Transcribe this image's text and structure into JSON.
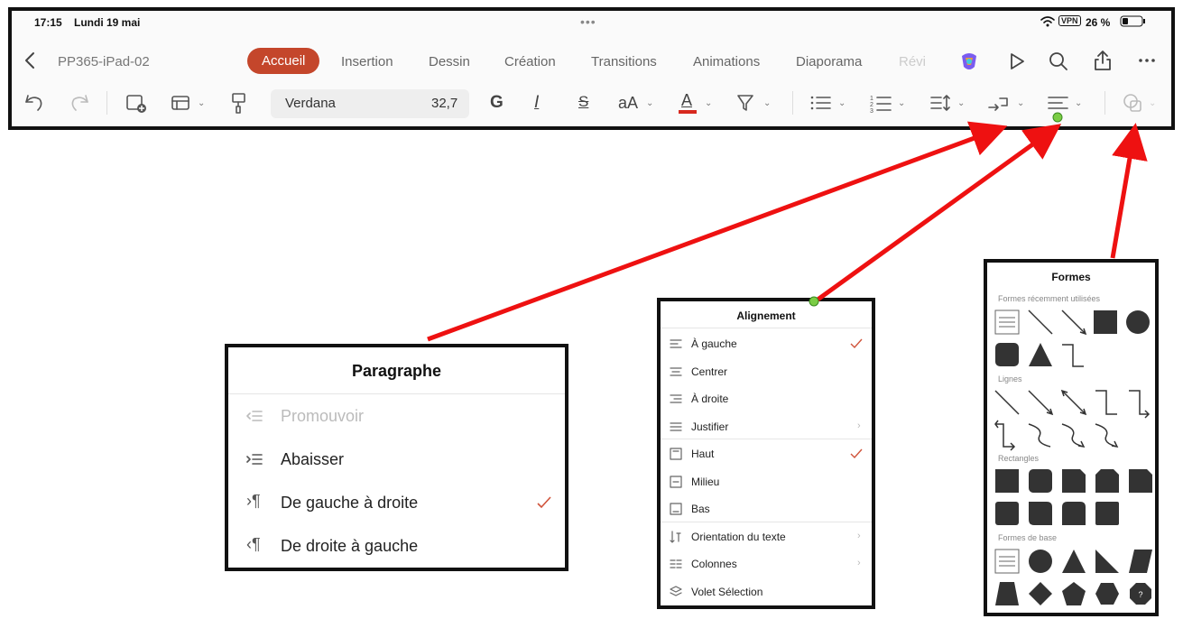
{
  "status_bar": {
    "time": "17:15",
    "date": "Lundi 19 mai",
    "dots": "•••",
    "vpn": "VPN",
    "battery": "26 %"
  },
  "header": {
    "title": "PP365-iPad-02"
  },
  "tabs": [
    {
      "label": "Accueil",
      "active": true
    },
    {
      "label": "Insertion"
    },
    {
      "label": "Dessin"
    },
    {
      "label": "Création"
    },
    {
      "label": "Transitions"
    },
    {
      "label": "Animations"
    },
    {
      "label": "Diaporama"
    },
    {
      "label": "Révi"
    }
  ],
  "toolbar": {
    "font_name": "Verdana",
    "font_size": "32,7",
    "bold": "G",
    "italic": "I",
    "strike": "S",
    "case": "aA",
    "font_color_letter": "A"
  },
  "colors": {
    "accent": "#c4462b",
    "arrow": "#ee1111",
    "check": "#d0533a"
  },
  "paragraph_panel": {
    "title": "Paragraphe",
    "items": [
      {
        "label": "Promouvoir",
        "enabled": false
      },
      {
        "label": "Abaisser",
        "enabled": true
      },
      {
        "label": "De gauche à droite",
        "enabled": true,
        "checked": true
      },
      {
        "label": "De droite à gauche",
        "enabled": true
      }
    ]
  },
  "alignment_panel": {
    "title": "Alignement",
    "items": [
      {
        "label": "À gauche",
        "checked": true
      },
      {
        "label": "Centrer"
      },
      {
        "label": "À droite"
      },
      {
        "label": "Justifier",
        "chevron": true
      },
      {
        "label": "Haut",
        "checked": true
      },
      {
        "label": "Milieu"
      },
      {
        "label": "Bas"
      },
      {
        "label": "Orientation du texte",
        "chevron": true
      },
      {
        "label": "Colonnes",
        "chevron": true
      },
      {
        "label": "Volet Sélection"
      }
    ]
  },
  "shapes_panel": {
    "title": "Formes",
    "sections": {
      "recent": "Formes récemment utilisées",
      "lines": "Lignes",
      "rectangles": "Rectangles",
      "basic": "Formes de base"
    },
    "badge": "?"
  }
}
